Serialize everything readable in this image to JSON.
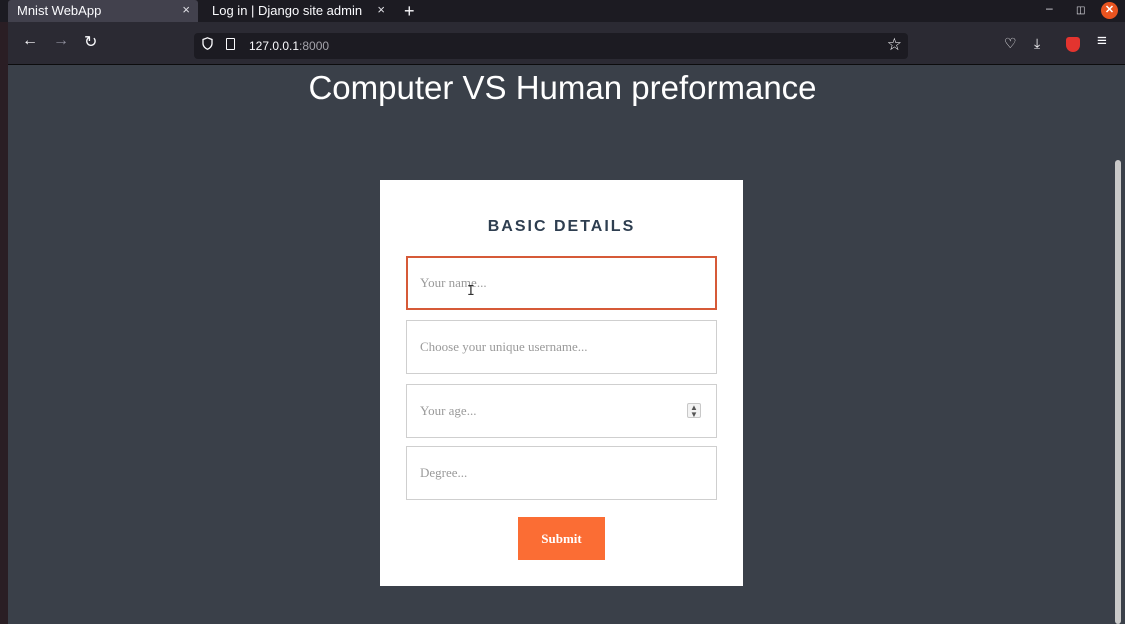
{
  "browser": {
    "tabs": [
      {
        "label": "Mnist WebApp",
        "close": "×"
      },
      {
        "label": "Log in | Django site admin",
        "close": "×"
      }
    ],
    "new_tab_label": "+",
    "url": {
      "host": "127.0.0.1",
      "port": ":8000"
    },
    "nav": {
      "back": "←",
      "forward": "→",
      "reload": "↻"
    },
    "window": {
      "minimize": "–",
      "maximize": "◫",
      "close": "✕"
    },
    "toolbar": {
      "pocket": "♡",
      "download": "⤓",
      "menu": "≡",
      "star": "☆"
    }
  },
  "page": {
    "title": "Computer VS Human preformance",
    "form": {
      "heading": "BASIC DETAILS",
      "name_placeholder": "Your name...",
      "username_placeholder": "Choose your unique username...",
      "age_placeholder": "Your age...",
      "degree_placeholder": "Degree...",
      "submit_label": "Submit"
    }
  },
  "colors": {
    "accent": "#fb6d34",
    "focus_border": "#d65a38",
    "page_bg": "#3a4049"
  }
}
